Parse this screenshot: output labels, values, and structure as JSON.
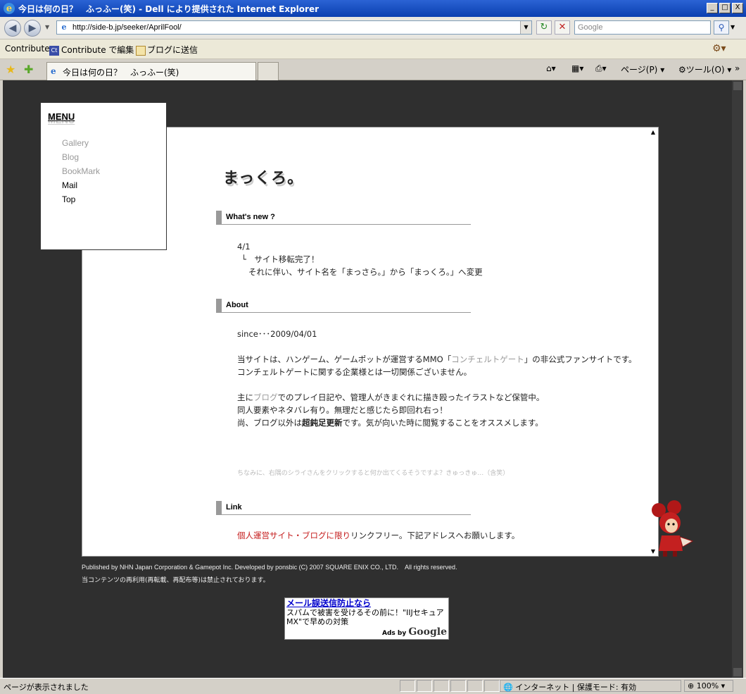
{
  "window": {
    "title": "今日は何の日？　ふっふー(笑) - Dell により提供された Internet Explorer",
    "controls": [
      "_",
      "□",
      "X"
    ]
  },
  "address_bar": {
    "url": "http://side-b.jp/seeker/AprilFool/",
    "search_placeholder": "Google"
  },
  "links_bar": {
    "contribute": "Contribute",
    "contribute_edit": "Contribute で編集",
    "blog_send": "ブログに送信"
  },
  "tab": {
    "label": "今日は何の日？　ふっふー(笑)"
  },
  "command_bar": {
    "page": "ページ(P)",
    "tools": "ツール(O)"
  },
  "menu": {
    "title": "MENU",
    "items": [
      "Gallery",
      "Blog",
      "BookMark",
      "Mail",
      "Top"
    ]
  },
  "site": {
    "title": "まっくろ。"
  },
  "whats_new": {
    "heading": "What's new ?",
    "date": "4/1",
    "line1": "└　サイト移転完了！",
    "line2": "それに伴い、サイト名を「まっさら。」から「まっくろ。」へ変更"
  },
  "about": {
    "heading": "About",
    "since": "since･･･2009/04/01",
    "p1a": "当サイトは、ハンゲーム、ゲームポットが運営するMMO「",
    "p1link": "コンチェルトゲート",
    "p1b": "」の非公式ファンサイトです。",
    "p2": "コンチェルトゲートに関する企業様とは一切関係ございません。",
    "p3a": "主に",
    "p3link": "ブログ",
    "p3b": "でのプレイ日記や、管理人がきまぐれに描き殴ったイラストなど保管中。",
    "p4": "同人要素やネタバレ有り。無理だと感じたら即回れ右っ！",
    "p5a": "尚、ブログ以外は",
    "p5bold": "超鈍足更新",
    "p5b": "です。気が向いた時に閲覧することをオススメします。",
    "note": "ちなみに、右隅のシライさんをクリックすると何か出てくるそうですよ？きゅっきゅ…（含笑）"
  },
  "link": {
    "heading": "Link",
    "text_red": "個人運営サイト・ブログに限り",
    "text": "リンクフリー。下記アドレスへお願いします。"
  },
  "footer": {
    "line1": "Published by NHN Japan Corporation & Gamepot Inc. Developed by ponsbic (C) 2007 SQUARE ENIX CO., LTD.　All rights reserved.",
    "line2": "当コンテンツの再利用(再転載、再配布等)は禁止されております。"
  },
  "ad": {
    "title": "メール誤送信防止なら",
    "text": "スパムで被害を受けるその前に！\"IIJセキュアMX\"で早めの対策",
    "by": "Ads by",
    "brand": "Google"
  },
  "status_bar": {
    "message": "ページが表示されました",
    "zone": "インターネット | 保護モード: 有効",
    "zoom": "100%"
  }
}
